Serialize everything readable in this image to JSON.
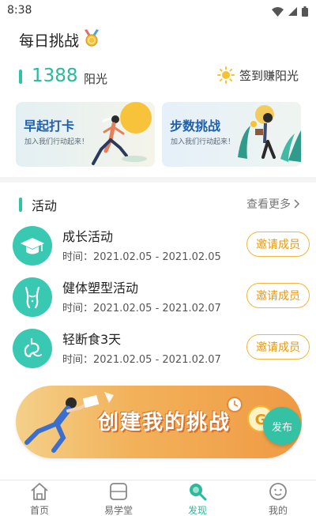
{
  "status_bar": {
    "time": "8:38"
  },
  "header": {
    "title": "每日挑战"
  },
  "sunshine": {
    "points": "1388",
    "unit": "阳光",
    "checkin_label": "签到赚阳光"
  },
  "cards": [
    {
      "title": "早起打卡",
      "subtitle": "加入我们行动起来！"
    },
    {
      "title": "步数挑战",
      "subtitle": "加入我们行动起来！"
    }
  ],
  "activities_section": {
    "title": "活动",
    "more_label": "查看更多"
  },
  "activities": [
    {
      "name": "成长活动",
      "time": "时间：2021.02.05 - 2021.02.05",
      "button": "邀请成员",
      "icon": "graduation-cap-icon"
    },
    {
      "name": "健体塑型活动",
      "time": "时间：2021.02.05 - 2021.02.07",
      "button": "邀请成员",
      "icon": "body-shape-icon"
    },
    {
      "name": "轻断食3天",
      "time": "时间：2021.02.05 - 2021.02.07",
      "button": "邀请成员",
      "icon": "stomach-icon"
    }
  ],
  "create_banner": {
    "text": "创建我的挑战",
    "publish_label": "发布"
  },
  "bottom_nav": [
    {
      "label": "首页",
      "icon": "home-icon"
    },
    {
      "label": "易学堂",
      "icon": "book-icon"
    },
    {
      "label": "发现",
      "icon": "discover-icon",
      "active": true
    },
    {
      "label": "我的",
      "icon": "profile-icon"
    }
  ],
  "colors": {
    "accent": "#2ab99a",
    "invite": "#e69a12",
    "card_title": "#1f5fb0"
  }
}
